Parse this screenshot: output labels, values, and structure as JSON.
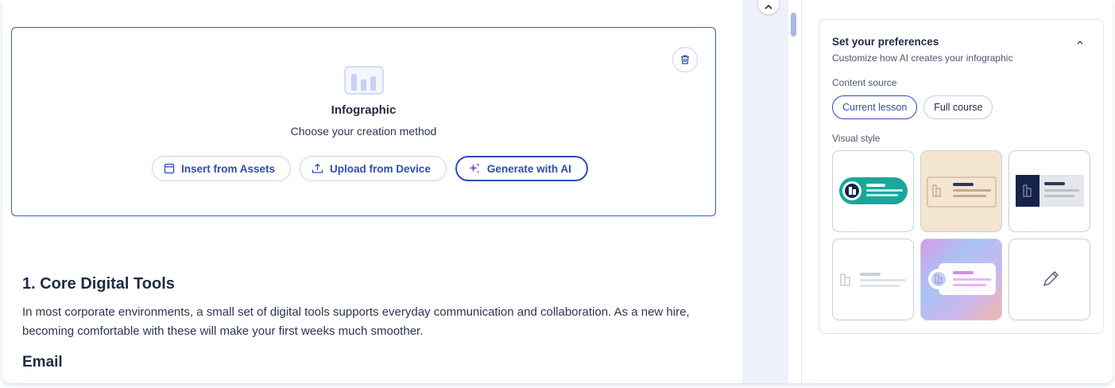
{
  "block": {
    "title": "Infographic",
    "subtitle": "Choose your creation method",
    "actions": {
      "insert_assets": "Insert from Assets",
      "upload_device": "Upload from Device",
      "generate_ai": "Generate with AI"
    }
  },
  "content": {
    "heading": "1. Core Digital Tools",
    "paragraph": "In most corporate environments, a small set of digital tools supports everyday communication and collaboration. As a new hire, becoming comfortable with these will make your first weeks much smoother.",
    "subheading": "Email"
  },
  "preferences": {
    "title": "Set your preferences",
    "subtitle": "Customize how AI creates your infographic",
    "content_source_label": "Content source",
    "content_source_options": [
      "Current lesson",
      "Full course"
    ],
    "content_source_selected": "Current lesson",
    "visual_style_label": "Visual style",
    "visual_styles": [
      "teal-pill",
      "beige-card",
      "navy-split",
      "minimal-gray",
      "gradient-holo",
      "custom-pencil"
    ]
  },
  "colors": {
    "accent": "#2f4bb8",
    "teal": "#1aa79a",
    "beige": "#f3e5d0",
    "navy": "#16244a"
  }
}
